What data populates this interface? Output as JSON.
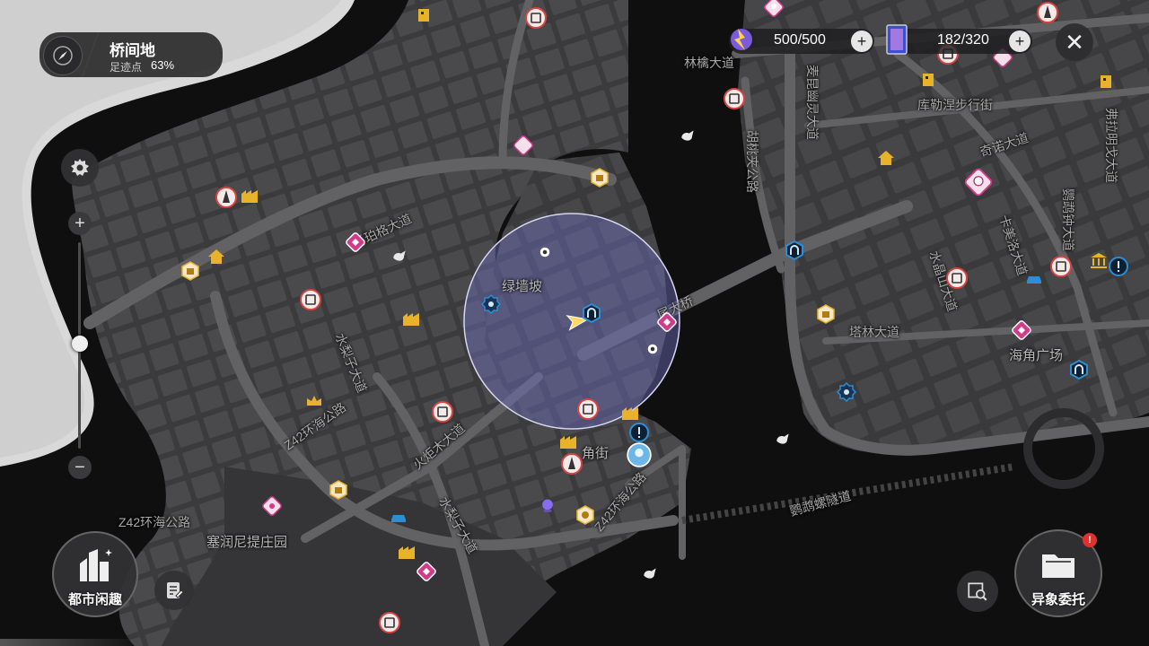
{
  "location": {
    "name": "桥间地",
    "progress_label": "足迹点",
    "progress_value": "63%",
    "progress_fraction": 0.63
  },
  "resources": {
    "energy": "500/500",
    "cards": "182/320"
  },
  "buttons": {
    "city_fun": "都市闲趣",
    "commission": "异象委托"
  },
  "streets": {
    "linqin": "林檎大道",
    "mati": "麦昆幽灵大道",
    "hutao": "胡桃夹公路",
    "kulenie": "库勒涅步行街",
    "qiqi": "奇诺大道",
    "folamingo": "弗拉明戈大道",
    "egyu": "鹦鹉钟大道",
    "kamei": "卡美洛大道",
    "shuijing": "水晶山大道",
    "talin": "塔林大道",
    "haijiao": "海角广场",
    "lvqiang": "绿墙坡",
    "weidaqiao": "尾大桥",
    "kepei": "肖珀格大道",
    "shuili": "水梨子大道",
    "z42a": "Z42环海公路",
    "huoju": "火炬木大道",
    "shuili2": "水梨子大道",
    "jiaojie": "角街",
    "z42b": "Z42环海公路",
    "z42c": "Z42环海公路",
    "sairun": "塞润尼提庄园",
    "yingwu": "鹦鹉螺隧道"
  },
  "colors": {
    "marker_red": "#d9433f",
    "marker_pink": "#d23a8a",
    "marker_gold": "#e8b22a",
    "marker_blue": "#2a8fd6",
    "range_circle": "#6a6ab6",
    "notification": "#e0312f"
  }
}
